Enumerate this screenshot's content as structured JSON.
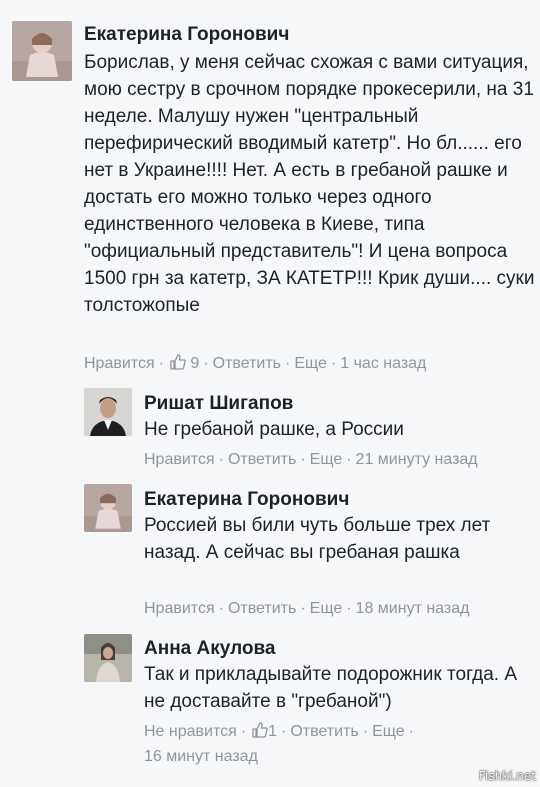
{
  "comments": [
    {
      "author": "Екатерина Горонович",
      "text": "Борислав, у меня сейчас схожая с вами ситуация, мою сестру в срочном порядке прокесерили, на 31 неделе. Малушу нужен \"центральный перефирический вводимый катетр\". Но бл...... его нет в Украине!!!! Нет. А есть в гребаной рашке и достать его можно только через одного единственного человека в Киеве, типа \"официальный представитель\"! И цена вопроса 1500 грн за катетр, ЗА КАТЕТР!!! Крик души.... суки толстожопые",
      "like_label": "Нравится",
      "like_count": "9",
      "reply_label": "Ответить",
      "more_label": "Еще",
      "time": "1 час назад"
    },
    {
      "author": "Ришат Шигапов",
      "text": "Не гребаной рашке, а России",
      "like_label": "Нравится",
      "reply_label": "Ответить",
      "more_label": "Еще",
      "time": "21 минуту назад"
    },
    {
      "author": "Екатерина Горонович",
      "text": "Россией вы били чуть больше трех лет назад. А сейчас вы гребаная рашка",
      "like_label": "Нравится",
      "reply_label": "Ответить",
      "more_label": "Еще",
      "time": "18 минут назад"
    },
    {
      "author": "Анна Акулова",
      "text": "Так и прикладывайте подорожник тогда. А не доставайте в \"гребаной\")",
      "like_label": "Не нравится",
      "like_count": "1",
      "reply_label": "Ответить",
      "more_label": "Еще",
      "time": "16 минут назад"
    }
  ],
  "icons": {
    "like": "thumbs-up-icon"
  },
  "colors": {
    "meta": "#90949c",
    "text": "#1d2129",
    "background": "#f6f7f9"
  },
  "watermark": "Fishki.net"
}
